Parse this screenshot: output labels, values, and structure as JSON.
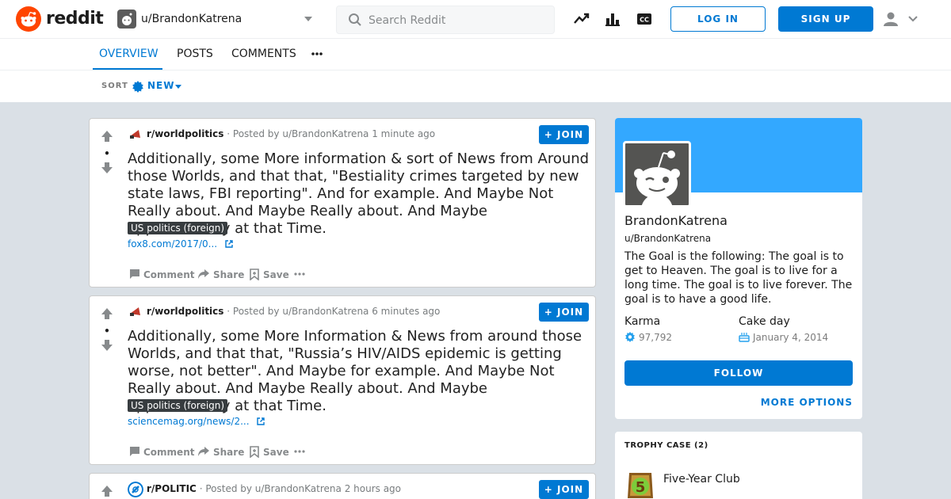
{
  "header": {
    "logo_text": "reddit",
    "username": "u/BrandonKatrena",
    "search_placeholder": "Search Reddit",
    "login_label": "LOG IN",
    "signup_label": "SIGN UP",
    "icons": [
      "trending-icon",
      "stats-icon",
      "closed-caption-icon",
      "user-icon"
    ]
  },
  "tabs": [
    {
      "label": "OVERVIEW",
      "active": true
    },
    {
      "label": "POSTS",
      "active": false
    },
    {
      "label": "COMMENTS",
      "active": false
    }
  ],
  "sort": {
    "label": "SORT",
    "value": "NEW"
  },
  "posts": [
    {
      "subreddit": "r/worldpolitics",
      "posted_by": "· Posted by u/BrandonKatrena",
      "time": "1 minute ago",
      "join_label": "JOIN",
      "title": "Additionally, some More information & sort of News from Around those Worlds, and that that, \"Bestiality crimes targeted by new state laws, FBI reporting\". And for example. And Maybe Not Really about. And Maybe Really about. And Maybe approximately at that Time.",
      "flair": "US politics (foreign)",
      "link": "fox8.com/2017/0...",
      "vote_score": "•",
      "actions": {
        "comment": "Comment",
        "share": "Share",
        "save": "Save"
      }
    },
    {
      "subreddit": "r/worldpolitics",
      "posted_by": "· Posted by u/BrandonKatrena",
      "time": "6 minutes ago",
      "join_label": "JOIN",
      "title": "Additionally, some More Information & News from around those Worlds, and that that, \"Russia’s HIV/AIDS epidemic is getting worse, not better\". And Maybe for example. And Maybe Not Really about. And Maybe Really about. And Maybe approximately at that Time.",
      "flair": "US politics (foreign)",
      "link": "sciencemag.org/news/2...",
      "vote_score": "•",
      "actions": {
        "comment": "Comment",
        "share": "Share",
        "save": "Save"
      }
    },
    {
      "subreddit": "r/POLITIC",
      "posted_by": "· Posted by u/BrandonKatrena",
      "time": "2 hours ago",
      "join_label": "JOIN"
    }
  ],
  "profile": {
    "display_name": "BrandonKatrena",
    "username": "u/BrandonKatrena",
    "bio": "The Goal is the following: The goal is to get to Heaven. The goal is to live for a long time. The goal is to live forever. The goal is to have a good life.",
    "karma_label": "Karma",
    "karma_value": "97,792",
    "cakeday_label": "Cake day",
    "cakeday_value": "January 4, 2014",
    "follow_label": "FOLLOW",
    "more_options_label": "MORE OPTIONS"
  },
  "trophy_case": {
    "title": "TROPHY CASE (2)",
    "first_trophy": "Five-Year Club"
  },
  "colors": {
    "accent": "#0079d3",
    "banner": "#33a8ff",
    "reddit_orange": "#ff4500",
    "flair_bg": "#373c3f"
  }
}
